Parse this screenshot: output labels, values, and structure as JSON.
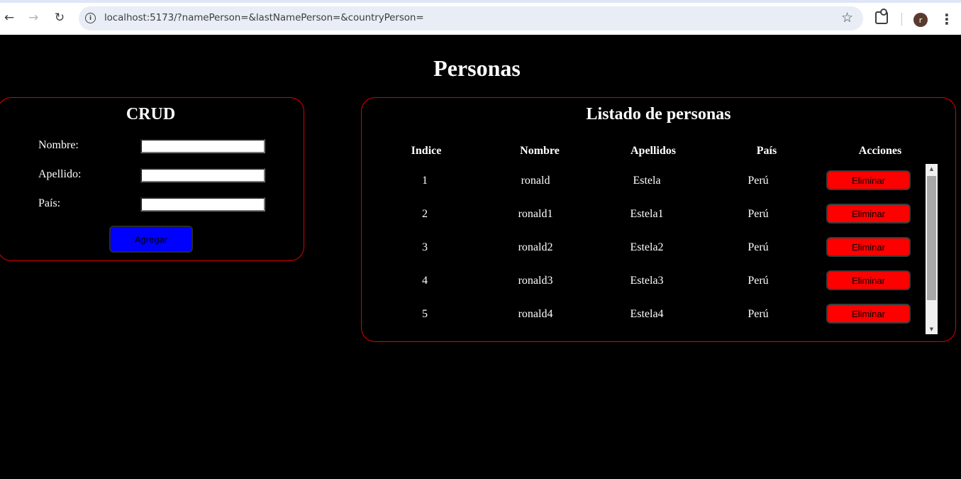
{
  "browser": {
    "url": "localhost:5173/?namePerson=&lastNamePerson=&countryPerson=",
    "back_icon": "←",
    "forward_icon": "→",
    "reload_icon": "↻",
    "info_icon": "i",
    "star_icon": "☆",
    "avatar_letter": "r",
    "menu_icon": "⋮"
  },
  "page": {
    "title": "Personas"
  },
  "crud": {
    "title": "CRUD",
    "fields": [
      {
        "label": "Nombre:",
        "value": ""
      },
      {
        "label": "Apellido:",
        "value": ""
      },
      {
        "label": "País:",
        "value": ""
      }
    ],
    "add_label": "Agregar"
  },
  "list": {
    "title": "Listado de personas",
    "headers": [
      "Indice",
      "Nombre",
      "Apellidos",
      "País",
      "Acciones"
    ],
    "rows": [
      {
        "index": "1",
        "name": "ronald",
        "last_name": "Estela",
        "country": "Perú",
        "action": "Eliminar"
      },
      {
        "index": "2",
        "name": "ronald1",
        "last_name": "Estela1",
        "country": "Perú",
        "action": "Eliminar"
      },
      {
        "index": "3",
        "name": "ronald2",
        "last_name": "Estela2",
        "country": "Perú",
        "action": "Eliminar"
      },
      {
        "index": "4",
        "name": "ronald3",
        "last_name": "Estela3",
        "country": "Perú",
        "action": "Eliminar"
      },
      {
        "index": "5",
        "name": "ronald4",
        "last_name": "Estela4",
        "country": "Perú",
        "action": "Eliminar"
      }
    ],
    "scroll_up_icon": "▲",
    "scroll_down_icon": "▼"
  },
  "colors": {
    "background": "#000000",
    "panel_border": "#e00000",
    "add_button": "#0000ff",
    "delete_button": "#ff0000"
  }
}
